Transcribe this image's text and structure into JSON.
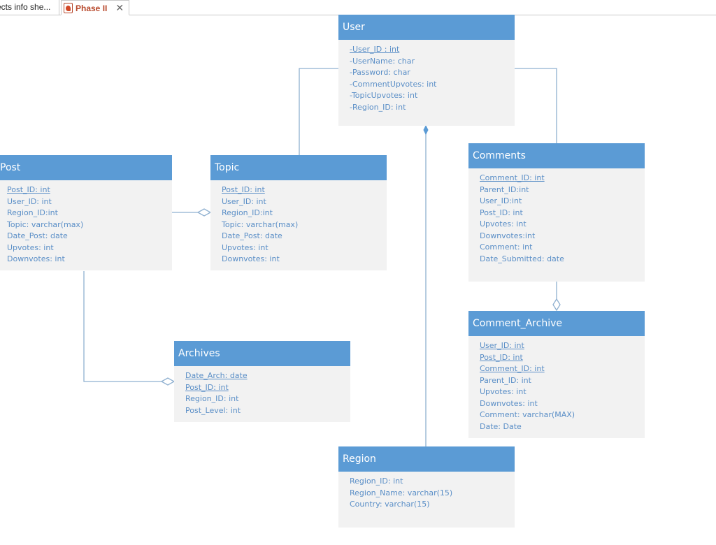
{
  "tabs": [
    {
      "label": "ects info she...",
      "active": false
    },
    {
      "label": "Phase II",
      "active": true,
      "icon": "powerpoint-icon",
      "close_icon": "close-icon",
      "close_glyph": "✕"
    }
  ],
  "colors": {
    "header_fill": "#5b9bd5",
    "body_fill": "#f2f2f2",
    "attribute_text": "#5b8fc7",
    "connector": "#8fb0d0"
  },
  "entities": {
    "user": {
      "title": "User",
      "attributes": [
        {
          "text": "-User_ID : int",
          "pk": true
        },
        {
          "text": "-UserName: char",
          "pk": false
        },
        {
          "text": "-Password: char",
          "pk": false
        },
        {
          "text": "-CommentUpvotes: int",
          "pk": false
        },
        {
          "text": "-TopicUpvotes: int",
          "pk": false
        },
        {
          "text": "-Region_ID: int",
          "pk": false
        }
      ]
    },
    "post": {
      "title": "Post",
      "attributes": [
        {
          "text": "Post_ID: int",
          "pk": true
        },
        {
          "text": "User_ID: int",
          "pk": false
        },
        {
          "text": "Region_ID:int",
          "pk": false
        },
        {
          "text": "Topic: varchar(max)",
          "pk": false
        },
        {
          "text": "Date_Post: date",
          "pk": false
        },
        {
          "text": "Upvotes: int",
          "pk": false
        },
        {
          "text": "Downvotes: int",
          "pk": false
        }
      ]
    },
    "topic": {
      "title": "Topic",
      "attributes": [
        {
          "text": "Post_ID: int",
          "pk": true
        },
        {
          "text": "User_ID: int",
          "pk": false
        },
        {
          "text": "Region_ID:int",
          "pk": false
        },
        {
          "text": "Topic: varchar(max)",
          "pk": false
        },
        {
          "text": "Date_Post: date",
          "pk": false
        },
        {
          "text": "Upvotes: int",
          "pk": false
        },
        {
          "text": "Downvotes: int",
          "pk": false
        }
      ]
    },
    "comments": {
      "title": "Comments",
      "attributes": [
        {
          "text": "Comment_ID: int",
          "pk": true
        },
        {
          "text": "Parent_ID:int",
          "pk": false
        },
        {
          "text": "User_ID:int",
          "pk": false
        },
        {
          "text": "Post_ID: int",
          "pk": false
        },
        {
          "text": "Upvotes: int",
          "pk": false
        },
        {
          "text": "Downvotes:int",
          "pk": false
        },
        {
          "text": "Comment: int",
          "pk": false
        },
        {
          "text": "Date_Submitted: date",
          "pk": false
        }
      ]
    },
    "comment_archive": {
      "title": "Comment_Archive",
      "attributes": [
        {
          "text": "User_ID: int",
          "pk": true
        },
        {
          "text": "Post_ID: int",
          "pk": true
        },
        {
          "text": "Comment_ID: int",
          "pk": true
        },
        {
          "text": "Parent_ID: int",
          "pk": false
        },
        {
          "text": "Upvotes: int",
          "pk": false
        },
        {
          "text": "Downvotes: int",
          "pk": false
        },
        {
          "text": "Comment: varchar(MAX)",
          "pk": false
        },
        {
          "text": "Date: Date",
          "pk": false
        }
      ]
    },
    "archives": {
      "title": "Archives",
      "attributes": [
        {
          "text": "Date_Arch: date",
          "pk": true
        },
        {
          "text": "Post_ID: int",
          "pk": true
        },
        {
          "text": "Region_ID: int",
          "pk": false
        },
        {
          "text": "Post_Level: int",
          "pk": false
        }
      ]
    },
    "region": {
      "title": "Region",
      "attributes": [
        {
          "text": "Region_ID: int",
          "pk": false
        },
        {
          "text": "Region_Name: varchar(15)",
          "pk": false
        },
        {
          "text": "Country: varchar(15)",
          "pk": false
        }
      ]
    }
  },
  "relationships": [
    {
      "from": "User",
      "to": "Topic",
      "end": "none"
    },
    {
      "from": "User",
      "to": "Comments",
      "end": "none"
    },
    {
      "from": "Region",
      "to": "User",
      "end": "composition"
    },
    {
      "from": "Post",
      "to": "Topic",
      "end": "aggregation"
    },
    {
      "from": "Post",
      "to": "Archives",
      "end": "aggregation"
    },
    {
      "from": "Comments",
      "to": "Comment_Archive",
      "end": "aggregation"
    }
  ]
}
